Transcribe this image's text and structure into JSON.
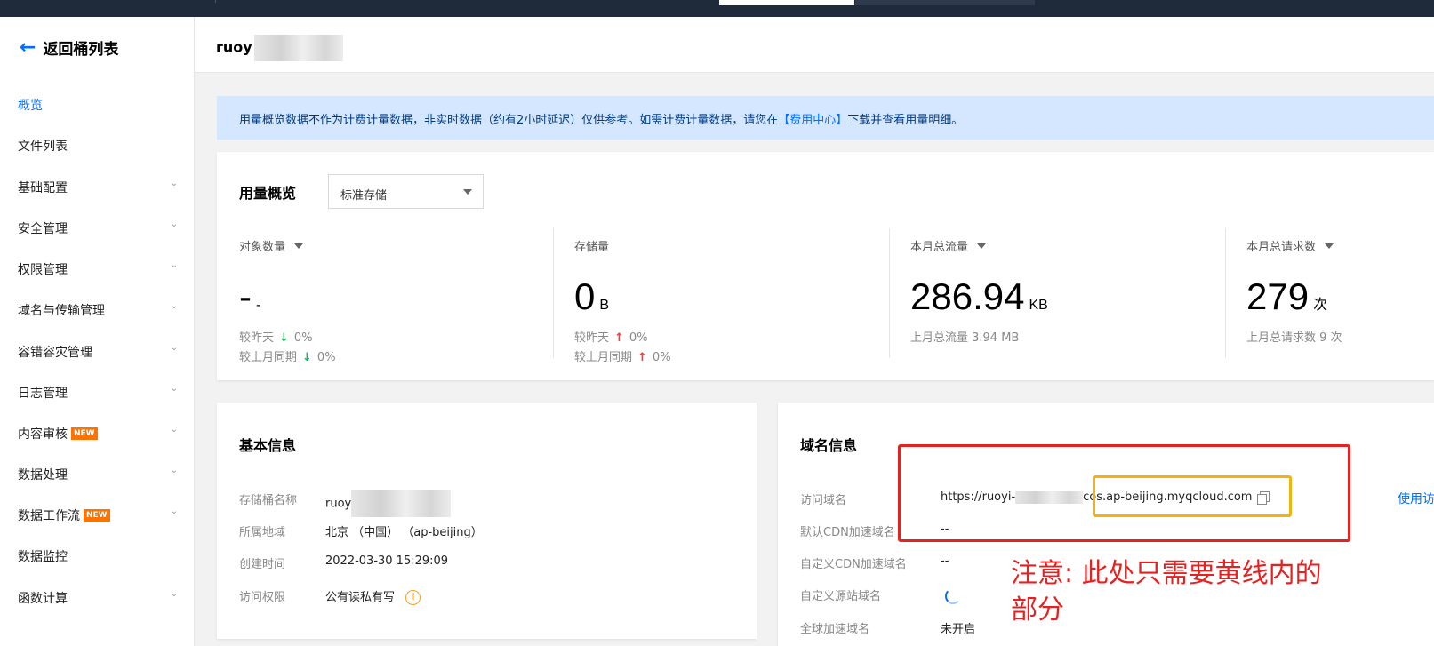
{
  "sidebar": {
    "back_label": "返回桶列表",
    "items": [
      {
        "label": "概览",
        "active": true,
        "chevron": false,
        "new": false
      },
      {
        "label": "文件列表",
        "active": false,
        "chevron": false,
        "new": false
      },
      {
        "label": "基础配置",
        "active": false,
        "chevron": true,
        "new": false
      },
      {
        "label": "安全管理",
        "active": false,
        "chevron": true,
        "new": false
      },
      {
        "label": "权限管理",
        "active": false,
        "chevron": true,
        "new": false
      },
      {
        "label": "域名与传输管理",
        "active": false,
        "chevron": true,
        "new": false
      },
      {
        "label": "容错容灾管理",
        "active": false,
        "chevron": true,
        "new": false
      },
      {
        "label": "日志管理",
        "active": false,
        "chevron": true,
        "new": false
      },
      {
        "label": "内容审核",
        "active": false,
        "chevron": true,
        "new": true
      },
      {
        "label": "数据处理",
        "active": false,
        "chevron": true,
        "new": false
      },
      {
        "label": "数据工作流",
        "active": false,
        "chevron": true,
        "new": true
      },
      {
        "label": "数据监控",
        "active": false,
        "chevron": false,
        "new": false
      },
      {
        "label": "函数计算",
        "active": false,
        "chevron": true,
        "new": false
      }
    ],
    "new_badge": "NEW"
  },
  "header": {
    "title": "ruoy"
  },
  "notice": {
    "text_before": "用量概览数据不作为计费计量数据，非实时数据（约有2小时延迟）仅供参考。如需计费计量数据，请您在",
    "link": "【费用中心】",
    "text_after": "下载并查看用量明细。"
  },
  "usage": {
    "title": "用量概览",
    "select_value": "标准存储",
    "metrics": [
      {
        "label": "对象数量",
        "dropdown": true,
        "value": "-",
        "unit": "-",
        "row1": "较昨天",
        "row1_trend": "down",
        "row1_pct": "0%",
        "row2": "较上月同期",
        "row2_trend": "down",
        "row2_pct": "0%"
      },
      {
        "label": "存储量",
        "dropdown": false,
        "value": "0",
        "unit": "B",
        "row1": "较昨天",
        "row1_trend": "up",
        "row1_pct": "0%",
        "row2": "较上月同期",
        "row2_trend": "up",
        "row2_pct": "0%"
      },
      {
        "label": "本月总流量",
        "dropdown": true,
        "value": "286.94",
        "unit": "KB",
        "row1": "上月总流量 3.94 MB"
      },
      {
        "label": "本月总请求数",
        "dropdown": true,
        "value": "279",
        "unit": "次",
        "row1": "上月总请求数 9 次"
      }
    ]
  },
  "basic": {
    "title": "基本信息",
    "rows": [
      {
        "key": "存储桶名称",
        "value": "ruoy"
      },
      {
        "key": "所属地域",
        "value": "北京 （中国） （ap-beijing）"
      },
      {
        "key": "创建时间",
        "value": "2022-03-30 15:29:09"
      },
      {
        "key": "访问权限",
        "value": "公有读私有写"
      }
    ]
  },
  "domain": {
    "title": "域名信息",
    "rows": [
      {
        "key": "访问域名",
        "value_prefix": "https://ruoyi-",
        "value_suffix": "cos.ap-beijing.myqcloud.com"
      },
      {
        "key": "默认CDN加速域名",
        "value": "--"
      },
      {
        "key": "自定义CDN加速域名",
        "value": "--"
      },
      {
        "key": "自定义源站域名",
        "value": ""
      },
      {
        "key": "全球加速域名",
        "value": "未开启"
      }
    ],
    "use_link": "使用访"
  },
  "annotation": {
    "text": "注意: 此处只需要黄线内的部分",
    "color": "#e52222",
    "highlight_color": "#f4b20e"
  },
  "colors": {
    "accent": "#006eff",
    "up": "#e54545",
    "down": "#0abf5b",
    "warn": "#ff9c19"
  }
}
